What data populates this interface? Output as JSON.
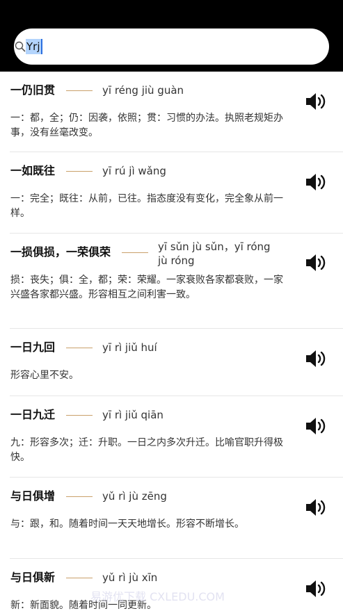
{
  "search": {
    "value": "Yrj",
    "icon": "search-icon"
  },
  "items": [
    {
      "idiom": "一仍旧贯",
      "pinyin": "yī réng jiù guàn",
      "desc": "一：都，全；仍：因袭，依照；贯：习惯的办法。执照老规矩办事，没有丝毫改变。"
    },
    {
      "idiom": "一如既往",
      "pinyin": "yī rú jì wǎng",
      "desc": "一：完全；既往：从前，已往。指态度没有变化，完全象从前一样。"
    },
    {
      "idiom": "一损俱损，一荣俱荣",
      "pinyin": "yī sǔn jù sǔn，yī róng jù róng",
      "desc": "损：丧失；俱：全，都；荣：荣耀。一家衰败各家都衰败，一家兴盛各家都兴盛。形容相互之间利害一致。"
    },
    {
      "idiom": "一日九回",
      "pinyin": "yī rì jiǔ huí",
      "desc": "形容心里不安。"
    },
    {
      "idiom": "一日九迁",
      "pinyin": "yī rì jiǔ qiān",
      "desc": "九：形容多次；迁：升职。一日之内多次升迁。比喻官职升得极快。"
    },
    {
      "idiom": "与日俱增",
      "pinyin": "yǔ rì jù zēng",
      "desc": "与：跟，和。随着时间一天天地增长。形容不断增长。"
    },
    {
      "idiom": "与日俱新",
      "pinyin": "yǔ rì jù xīn",
      "desc": "新：新面貌。随着时间一同更新。"
    }
  ],
  "watermark": "易游优下载 CXLEDU.COM"
}
